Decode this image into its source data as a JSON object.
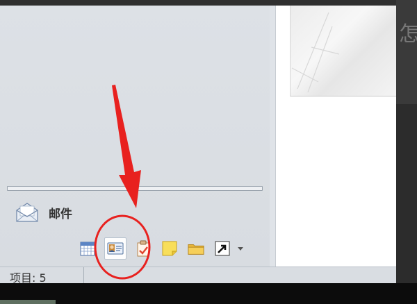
{
  "navigation": {
    "mail_label": "邮件",
    "icons": [
      "calendar-icon",
      "contacts-icon",
      "tasks-icon",
      "notes-icon",
      "folder-list-icon",
      "shortcuts-icon"
    ],
    "selected_icon": "contacts-icon"
  },
  "reading_pane": {
    "ghost_text": "怎"
  },
  "status_bar": {
    "items_text": "项目: 5"
  },
  "colors": {
    "annotation": "#e8211f",
    "nav_bg": "#dde1e6",
    "accent_folder": "#f2c34a"
  }
}
